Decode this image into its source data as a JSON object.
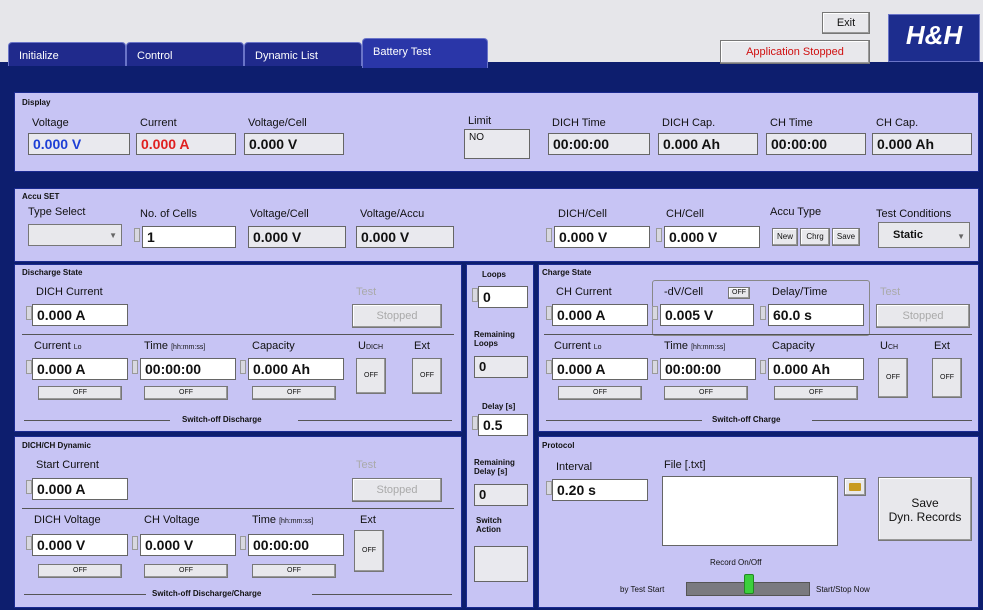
{
  "app": {
    "exit_label": "Exit",
    "status_label": "Application Stopped",
    "logo_text": "H&H"
  },
  "tabs": [
    {
      "label": "Initialize"
    },
    {
      "label": "Control"
    },
    {
      "label": "Dynamic List"
    },
    {
      "label": "Battery Test"
    }
  ],
  "display": {
    "title": "Display",
    "voltage_label": "Voltage",
    "voltage_value": "0.000 V",
    "voltage_color": "#1d3fd6",
    "current_label": "Current",
    "current_value": "0.000 A",
    "current_color": "#e02020",
    "vcell_label": "Voltage/Cell",
    "vcell_value": "0.000 V",
    "limit_label": "Limit",
    "limit_value": "NO",
    "dich_time_label": "DICH Time",
    "dich_time_value": "00:00:00",
    "dich_cap_label": "DICH Cap.",
    "dich_cap_value": "0.000 Ah",
    "ch_time_label": "CH Time",
    "ch_time_value": "00:00:00",
    "ch_cap_label": "CH Cap.",
    "ch_cap_value": "0.000 Ah"
  },
  "accu": {
    "title": "Accu SET",
    "type_select_label": "Type Select",
    "cells_label": "No. of Cells",
    "cells_value": "1",
    "vcell_label": "Voltage/Cell",
    "vcell_value": "0.000 V",
    "vaccu_label": "Voltage/Accu",
    "vaccu_value": "0.000 V",
    "dich_cell_label": "DICH/Cell",
    "dich_cell_value": "0.000 V",
    "ch_cell_label": "CH/Cell",
    "ch_cell_value": "0.000 V",
    "accu_type_label": "Accu Type",
    "new_label": "New",
    "chrg_label": "Chrg",
    "save_label": "Save",
    "cond_label": "Test Conditions",
    "cond_value": "Static"
  },
  "discharge": {
    "title": "Discharge State",
    "dich_current_label": "DICH Current",
    "dich_current_value": "0.000 A",
    "test_label": "Test",
    "stopped_label": "Stopped",
    "current_label": "Current",
    "current_sub": "Lo",
    "current_value": "0.000 A",
    "time_label": "Time",
    "time_sub": "[hh:mm:ss]",
    "time_value": "00:00:00",
    "capacity_label": "Capacity",
    "capacity_value": "0.000 Ah",
    "udich_label": "U",
    "udich_sub": "DICH",
    "ext_label": "Ext",
    "off": "OFF",
    "switch_label": "Switch-off Discharge"
  },
  "dyn": {
    "title": "DICH/CH Dynamic",
    "start_label": "Start Current",
    "start_value": "0.000 A",
    "test_label": "Test",
    "stopped_label": "Stopped",
    "dichv_label": "DICH Voltage",
    "dichv_value": "0.000 V",
    "chv_label": "CH Voltage",
    "chv_value": "0.000 V",
    "time_label": "Time",
    "time_sub": "[hh:mm:ss]",
    "time_value": "00:00:00",
    "ext_label": "Ext",
    "off": "OFF",
    "switch_label": "Switch-off Discharge/Charge"
  },
  "loops": {
    "loops_label": "Loops",
    "loops_value": "0",
    "remaining_label": "Remaining Loops",
    "remaining_value": "0",
    "delay_label": "Delay [s]",
    "delay_value": "0.5",
    "rem_delay_label": "Remaining Delay [s]",
    "rem_delay_value": "0",
    "switch_action_label": "Switch Action"
  },
  "charge": {
    "title": "Charge State",
    "ch_current_label": "CH Current",
    "ch_current_value": "0.000 A",
    "dv_label": "-dV/Cell",
    "dv_toggle": "OFF",
    "dv_value": "0.005 V",
    "delay_label": "Delay/Time",
    "delay_value": "60.0 s",
    "test_label": "Test",
    "stopped_label": "Stopped",
    "current_label": "Current",
    "current_sub": "Lo",
    "current_value": "0.000 A",
    "time_label": "Time",
    "time_sub": "[hh:mm:ss]",
    "time_value": "00:00:00",
    "capacity_label": "Capacity",
    "capacity_value": "0.000 Ah",
    "uch_label": "U",
    "uch_sub": "CH",
    "ext_label": "Ext",
    "off": "OFF",
    "switch_label": "Switch-off Charge"
  },
  "protocol": {
    "title": "Protocol",
    "interval_label": "Interval",
    "interval_value": "0.20 s",
    "file_label": "File [.txt]",
    "save_label_1": "Save",
    "save_label_2": "Dyn. Records",
    "record_label": "Record On/Off",
    "by_test_label": "by Test Start",
    "start_stop_label": "Start/Stop Now"
  }
}
